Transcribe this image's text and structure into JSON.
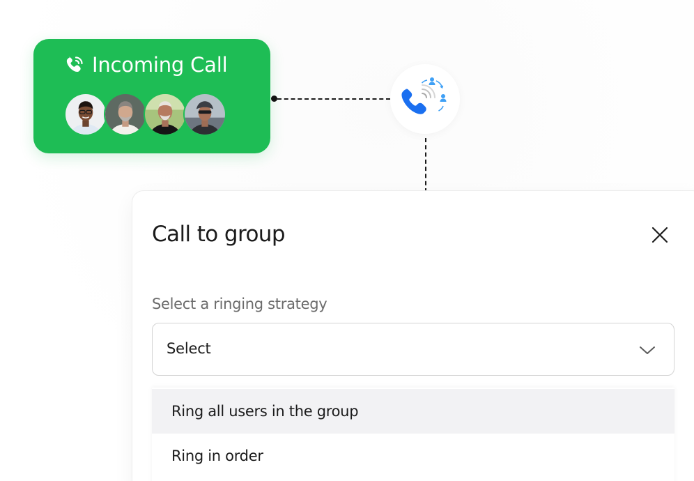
{
  "incoming_call": {
    "title": "Incoming Call",
    "icon": "phone-ringing-icon",
    "avatars": [
      "avatar-person-1",
      "avatar-person-2",
      "avatar-person-3",
      "avatar-person-4"
    ],
    "accent_color": "#1ebd55"
  },
  "group_icon": "group-call-icon",
  "dialog": {
    "title": "Call to group",
    "close_icon": "close-icon",
    "field_label": "Select a ringing strategy",
    "select": {
      "value": "Select",
      "icon": "chevron-down-icon"
    },
    "options": [
      {
        "label": "Ring all users in the group",
        "hovered": true
      },
      {
        "label": "Ring in order",
        "hovered": false
      }
    ]
  }
}
